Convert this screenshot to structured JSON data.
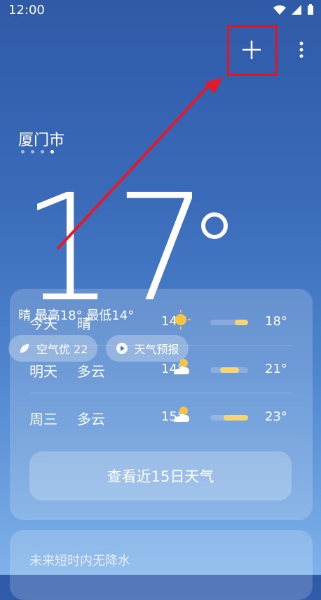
{
  "status": {
    "time": "12:00"
  },
  "location": {
    "city": "厦门市",
    "page_count": 4,
    "active_index": 3
  },
  "current": {
    "temp": "17",
    "unit_icon": "degree-icon"
  },
  "summary": "晴 最高18° 最低14°",
  "chips": {
    "aqi": "空气优 22",
    "forecast": "天气预报"
  },
  "forecast": [
    {
      "day": "今天",
      "cond": "晴",
      "low": "14°",
      "high": "18°",
      "bar": {
        "from": 0.65,
        "to": 1.0
      },
      "icon": "sunny-icon"
    },
    {
      "day": "明天",
      "cond": "多云",
      "low": "14°",
      "high": "21°",
      "bar": {
        "from": 0.25,
        "to": 0.75
      },
      "icon": "partly-cloudy-icon"
    },
    {
      "day": "周三",
      "cond": "多云",
      "low": "15°",
      "high": "23°",
      "bar": {
        "from": 0.35,
        "to": 1.0
      },
      "icon": "partly-cloudy-icon"
    }
  ],
  "cta": {
    "label": "查看近15日天气"
  },
  "bottom": {
    "label": "未来短时内无降水"
  }
}
